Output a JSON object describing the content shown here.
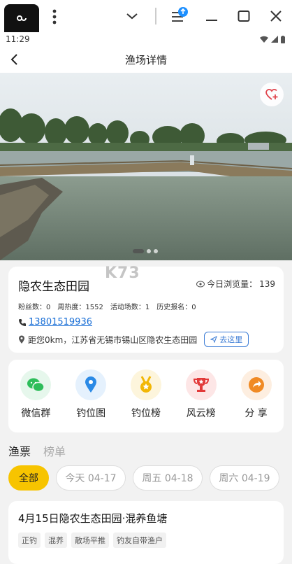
{
  "status": {
    "time": "11:29"
  },
  "nav": {
    "title": "渔场详情"
  },
  "info": {
    "name": "隐农生态田园",
    "views_label": "今日浏览量：",
    "views_value": "139",
    "stats": [
      "粉丝数：0",
      "周热度：1552",
      "活动场数：1",
      "历史报名：0"
    ],
    "phone": "13801519936",
    "address": "距您0km，江苏省无锡市锡山区隐农生态田园",
    "goto_label": "去这里"
  },
  "menu": [
    {
      "label": "微信群",
      "icon": "wechat-icon",
      "bg": "#e6f7ec",
      "color": "#2dbd5a"
    },
    {
      "label": "钓位图",
      "icon": "location-pin-icon",
      "bg": "#e5f1fd",
      "color": "#2b8ae6"
    },
    {
      "label": "钓位榜",
      "icon": "medal-icon",
      "bg": "#fdf5dc",
      "color": "#f2b705"
    },
    {
      "label": "风云榜",
      "icon": "trophy-icon",
      "bg": "#fde6e6",
      "color": "#e23a3a"
    },
    {
      "label": "分 享",
      "icon": "share-icon",
      "bg": "#fdeee0",
      "color": "#f08a24"
    }
  ],
  "tabs": {
    "active": "渔票",
    "inactive": "榜单"
  },
  "dates": [
    "全部",
    "今天 04-17",
    "周五 04-18",
    "周六 04-19"
  ],
  "ticket": {
    "title": "4月15日隐农生态田园·混养鱼塘",
    "tags": [
      "正钓",
      "混养",
      "散场平推",
      "钓友自带渔户"
    ]
  },
  "watermark": "K73"
}
